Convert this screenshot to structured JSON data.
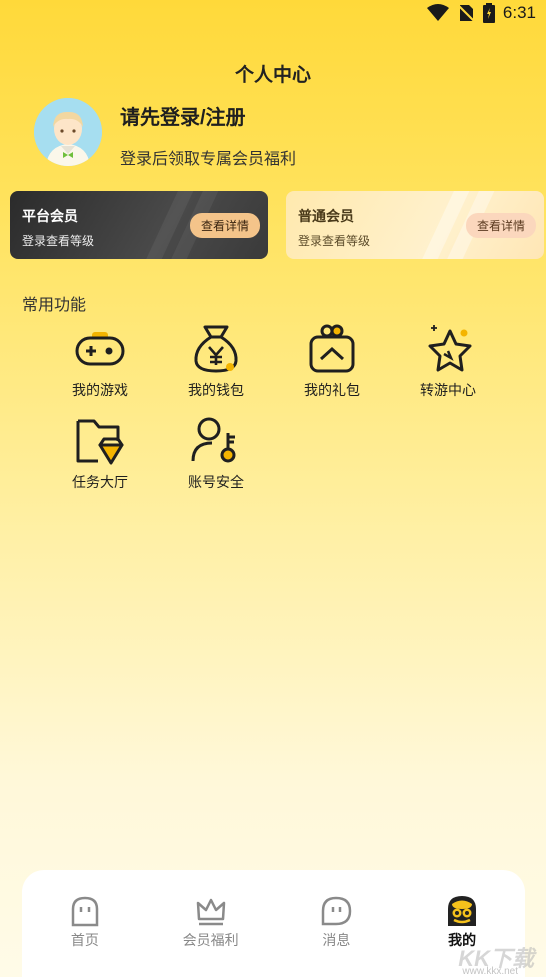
{
  "status_bar": {
    "time": "6:31"
  },
  "header": {
    "title": "个人中心"
  },
  "profile": {
    "login_title": "请先登录/注册",
    "login_subtitle": "登录后领取专属会员福利"
  },
  "cards": [
    {
      "title": "平台会员",
      "desc": "登录查看等级",
      "button": "查看详情"
    },
    {
      "title": "普通会员",
      "desc": "登录查看等级",
      "button": "查看详情"
    }
  ],
  "functions": {
    "section_title": "常用功能",
    "items": [
      {
        "label": "我的游戏",
        "icon": "gamepad-icon"
      },
      {
        "label": "我的钱包",
        "icon": "money-bag-icon"
      },
      {
        "label": "我的礼包",
        "icon": "gift-icon"
      },
      {
        "label": "转游中心",
        "icon": "star-icon"
      },
      {
        "label": "任务大厅",
        "icon": "folder-diamond-icon"
      },
      {
        "label": "账号安全",
        "icon": "user-key-icon"
      }
    ]
  },
  "tab_bar": {
    "items": [
      {
        "label": "首页",
        "icon": "home-ghost-icon",
        "active": false
      },
      {
        "label": "会员福利",
        "icon": "crown-icon",
        "active": false
      },
      {
        "label": "消息",
        "icon": "message-ghost-icon",
        "active": false
      },
      {
        "label": "我的",
        "icon": "profile-mascot-icon",
        "active": true
      }
    ]
  },
  "watermark": {
    "text": "KK下载",
    "url": "www.kkx.net"
  },
  "colors": {
    "accent_yellow": "#ffd93a",
    "dark_card": "#2b2b2b",
    "tab_active": "#111111"
  }
}
